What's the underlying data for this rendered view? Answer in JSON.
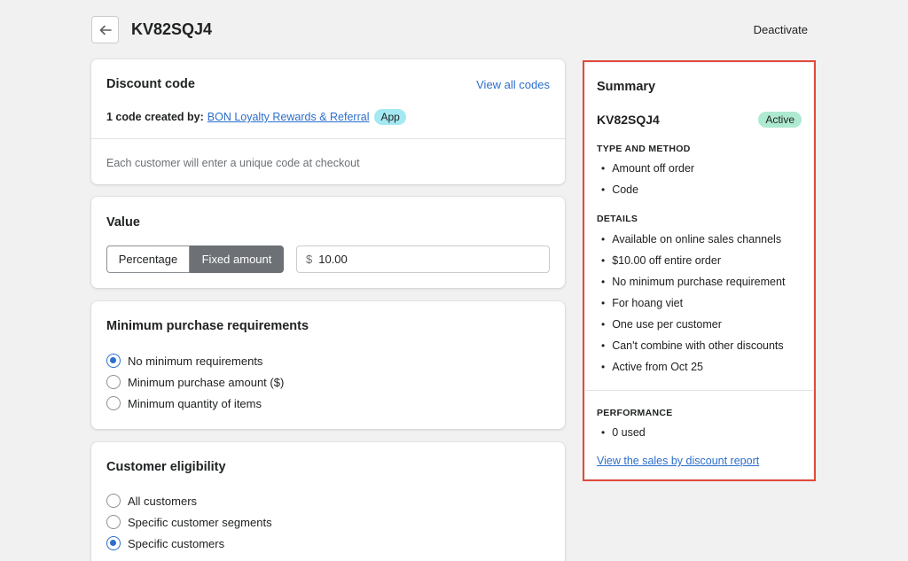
{
  "header": {
    "title": "KV82SQJ4",
    "deactivate_label": "Deactivate"
  },
  "discount_card": {
    "title": "Discount code",
    "view_all_label": "View all codes",
    "created_by_label": "1 code created by:",
    "app_name": "BON Loyalty Rewards & Referral",
    "app_badge": "App",
    "hint": "Each customer will enter a unique code at checkout"
  },
  "value_card": {
    "title": "Value",
    "options": [
      "Percentage",
      "Fixed amount"
    ],
    "selected_option": "Fixed amount",
    "currency_prefix": "$",
    "amount_value": "10.00"
  },
  "min_card": {
    "title": "Minimum purchase requirements",
    "options": [
      "No minimum requirements",
      "Minimum purchase amount ($)",
      "Minimum quantity of items"
    ],
    "selected_index": 0
  },
  "eligibility_card": {
    "title": "Customer eligibility",
    "options": [
      "All customers",
      "Specific customer segments",
      "Specific customers"
    ],
    "selected_index": 2
  },
  "summary": {
    "title": "Summary",
    "code": "KV82SQJ4",
    "status": "Active",
    "type_heading": "TYPE AND METHOD",
    "type_items": [
      "Amount off order",
      "Code"
    ],
    "details_heading": "DETAILS",
    "details_items": [
      "Available on online sales channels",
      "$10.00 off entire order",
      "No minimum purchase requirement",
      "For hoang viet",
      "One use per customer",
      "Can't combine with other discounts",
      "Active from Oct 25"
    ],
    "performance_heading": "PERFORMANCE",
    "performance_items": [
      "0 used"
    ],
    "report_link": "View the sales by discount report"
  },
  "colors": {
    "accent": "#2c6ecb",
    "highlight_border": "#e34a3c",
    "active_badge": "#aee9d1",
    "app_badge": "#a4e8f2"
  },
  "icons": {
    "back": "arrow-left-icon"
  }
}
